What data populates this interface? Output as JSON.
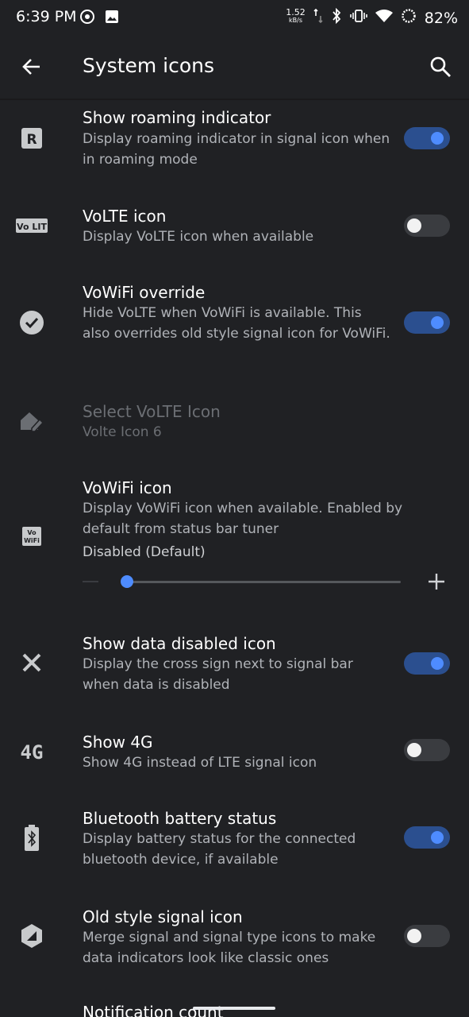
{
  "status_bar": {
    "time": "6:39 PM",
    "speed_value": "1.52",
    "speed_unit": "kB/s",
    "battery": "82%"
  },
  "app_bar": {
    "title": "System icons"
  },
  "settings": [
    {
      "title": "Show roaming indicator",
      "subtitle": "Display roaming indicator in signal icon when in roaming mode",
      "toggle": true
    },
    {
      "title": "VoLTE icon",
      "subtitle": "Display VoLTE icon when available",
      "toggle": false
    },
    {
      "title": "VoWiFi override",
      "subtitle": "Hide VoLTE when VoWiFi is available. This also overrides old style signal icon for VoWiFi.",
      "toggle": true
    },
    {
      "title": "Select VoLTE Icon",
      "subtitle": "Volte Icon 6",
      "disabled": true
    },
    {
      "title": "VoWiFi icon",
      "subtitle": "Display VoWiFi icon when available. Enabled by default from status bar tuner",
      "value": "Disabled (Default)"
    },
    {
      "title": "Show data disabled icon",
      "subtitle": "Display the cross sign next to signal bar when data is disabled",
      "toggle": true
    },
    {
      "title": "Show 4G",
      "subtitle": "Show 4G instead of LTE signal icon",
      "toggle": false
    },
    {
      "title": "Bluetooth battery status",
      "subtitle": "Display battery status for the connected bluetooth device, if available",
      "toggle": true
    },
    {
      "title": "Old style signal icon",
      "subtitle": "Merge signal and signal type icons to make data indicators look like classic ones",
      "toggle": false
    },
    {
      "title": "Notification count"
    }
  ],
  "icon_text": {
    "roaming": "R",
    "volte": "Vo LIT",
    "vowifi_top": "Vo",
    "vowifi_bottom": "WiFi",
    "four_g": "4G"
  },
  "colors": {
    "background": "#202124",
    "accent": "#4e8cff",
    "switch_track_on": "#2b4f8f"
  }
}
